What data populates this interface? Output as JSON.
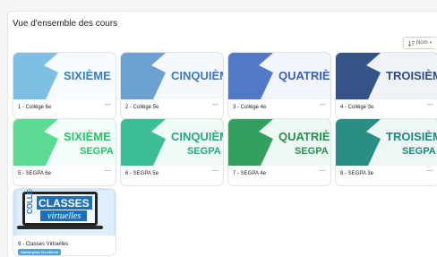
{
  "page": {
    "title": "Vue d'ensemble des cours"
  },
  "sort": {
    "label": "Nom",
    "icon": "sort-icon",
    "arrow": "▾"
  },
  "menu_glyph": "···",
  "courses": [
    {
      "name": "1 - Collège 6e",
      "banner": "SIXIÈME",
      "sub": "",
      "bg": "#8ecbe9",
      "blob": "#6fb5dd",
      "text": "#3a7eb7"
    },
    {
      "name": "2 - Collège 5e",
      "banner": "CINQUIÈME",
      "sub": "",
      "bg": "#7fb0dc",
      "blob": "#5d94c9",
      "text": "#3d78b6"
    },
    {
      "name": "3 - Collège 4e",
      "banner": "QUATRIÈME",
      "sub": "",
      "bg": "#5d86cf",
      "blob": "#4a6ec0",
      "text": "#3761b5"
    },
    {
      "name": "4 - Collège 3e",
      "banner": "TROISIÈME",
      "sub": "",
      "bg": "#3a5c92",
      "blob": "#2f4d7c",
      "text": "#2f4d7c"
    },
    {
      "name": "5 - SEGPA 6e",
      "banner": "SIXIÈME",
      "sub": "SEGPA",
      "bg": "#6be39e",
      "blob": "#4fd486",
      "text": "#2fbf6c"
    },
    {
      "name": "6 - SEGPA 5e",
      "banner": "CINQUIÈME",
      "sub": "SEGPA",
      "bg": "#45c9a2",
      "blob": "#34b28d",
      "text": "#2aa581"
    },
    {
      "name": "7 - SEGPA 4e",
      "banner": "QUATRIÈME",
      "sub": "SEGPA",
      "bg": "#3aae6a",
      "blob": "#2e9558",
      "text": "#2a8e52"
    },
    {
      "name": "8 - SEGPA 3e",
      "banner": "TROISIÈME",
      "sub": "SEGPA",
      "bg": "#2f9a8f",
      "blob": "#24857b",
      "text": "#21867c"
    }
  ],
  "virtual": {
    "name": "9 - Classes Virtuelles",
    "badge": "Caché pour les élèves",
    "side": "COLLÈGE",
    "line1": "CLASSES",
    "line2": "virtuelles",
    "bg": "#cfe6f7"
  }
}
